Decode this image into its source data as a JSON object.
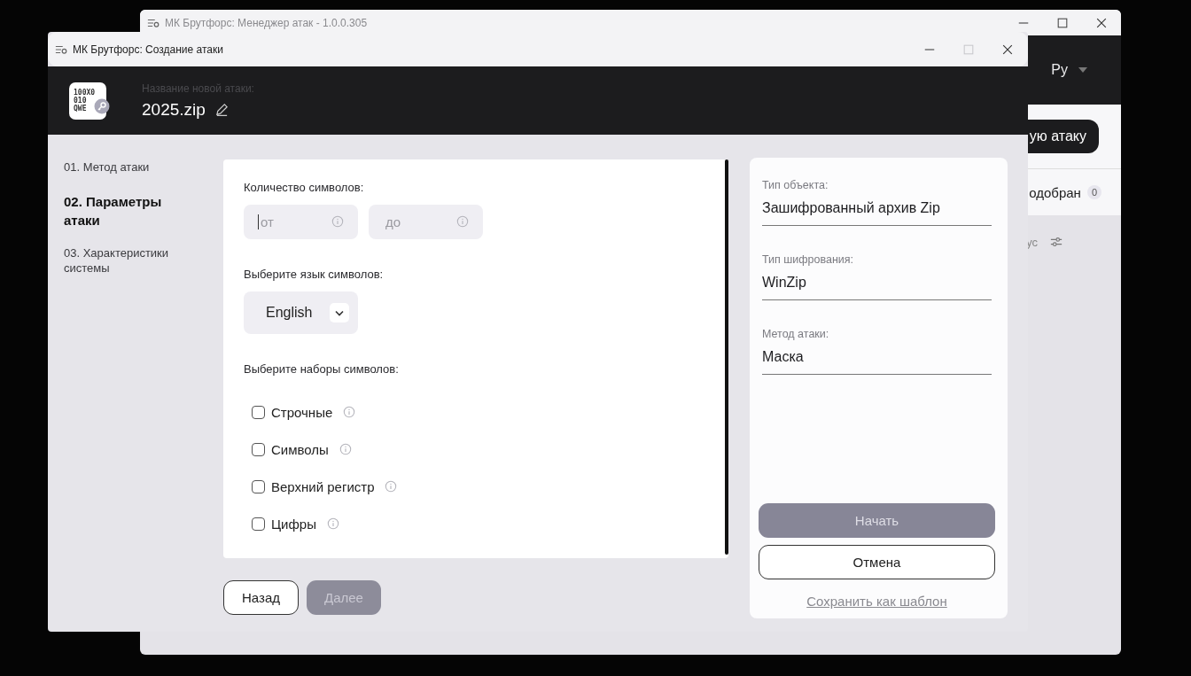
{
  "background_window": {
    "title": "МК Брутфорс: Менеджер атак - 1.0.0.305",
    "language": "Ру",
    "new_attack_button": "ую атаку",
    "status_tab": {
      "label": "одобран",
      "count": "0"
    },
    "filter_label": "ус"
  },
  "dialog": {
    "title": "МК Брутфорс: Создание атаки",
    "logo_lines": [
      "100X0",
      "010",
      "QWE"
    ],
    "name_label": "Название новой атаки:",
    "name": "2025.zip"
  },
  "steps": [
    {
      "label": "01. Метод атаки",
      "selected": false
    },
    {
      "label": "02. Параметры атаки",
      "selected": true
    },
    {
      "label": "03. Характеристики системы",
      "selected": false
    }
  ],
  "char_count": {
    "label": "Количество символов:",
    "fields": [
      {
        "placeholder": "от",
        "focused": true
      },
      {
        "placeholder": "до",
        "focused": false
      }
    ]
  },
  "language": {
    "label": "Выберите язык символов:",
    "value": "English"
  },
  "charsets": {
    "label": "Выберите наборы символов:",
    "items": [
      {
        "label": "Строчные",
        "checked": false
      },
      {
        "label": "Символы",
        "checked": false
      },
      {
        "label": "Верхний регистр",
        "checked": false
      },
      {
        "label": "Цифры",
        "checked": false
      }
    ]
  },
  "nav_buttons": [
    {
      "label": "Назад",
      "disabled": false
    },
    {
      "label": "Далее",
      "disabled": true
    }
  ],
  "summary": [
    {
      "label": "Тип объекта:",
      "value": "Зашифрованный архив Zip"
    },
    {
      "label": "Тип шифрования:",
      "value": "WinZip"
    },
    {
      "label": "Метод атаки:",
      "value": "Маска"
    }
  ],
  "actions": [
    {
      "label": "Начать",
      "kind": "primary",
      "disabled": true
    },
    {
      "label": "Отмена",
      "kind": "outline",
      "disabled": false
    },
    {
      "label": "Сохранить как шаблон",
      "kind": "link",
      "disabled": false
    }
  ]
}
